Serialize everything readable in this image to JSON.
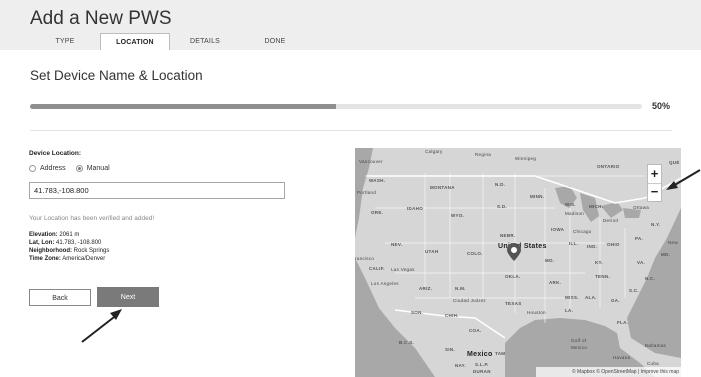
{
  "header": {
    "title": "Add a New PWS",
    "tabs": [
      "TYPE",
      "LOCATION",
      "DETAILS",
      "DONE"
    ],
    "active_tab": "LOCATION"
  },
  "section": {
    "title": "Set Device Name & Location"
  },
  "progress": {
    "value": 0.5,
    "label": "50%"
  },
  "form": {
    "device_location_label": "Device Location:",
    "radio_options": [
      {
        "label": "Address",
        "checked": false
      },
      {
        "label": "Manual",
        "checked": true
      }
    ],
    "coordinates_value": "41.783,-108.800",
    "verified_message": "Your Location has been verified and added!",
    "details": [
      {
        "key": "Elevation:",
        "value": "2061 m"
      },
      {
        "key": "Lat, Lon:",
        "value": "41.783, -108.800"
      },
      {
        "key": "Neighborhood:",
        "value": "Rock Springs"
      },
      {
        "key": "Time Zone:",
        "value": "America/Denver"
      }
    ],
    "back_label": "Back",
    "next_label": "Next"
  },
  "map": {
    "zoom_in": "+",
    "zoom_out": "−",
    "attribution": "© Mapbox © OpenStreetMap | Improve this map",
    "labels": {
      "calgary": "Calgary",
      "regina": "Regina",
      "winnipeg": "Winnipeg",
      "ontario": "ONTARIO",
      "que": "QUÉ",
      "vancouver": "Vancouver",
      "wash": "WASH.",
      "montana": "MONTANA",
      "nd": "N.D.",
      "minn": "MINN.",
      "portland": "Portland",
      "sd": "S.D.",
      "wis": "WIS.",
      "mich": "MICH.",
      "ottawa": "Ottawa",
      "ore": "ORE.",
      "idaho": "IDAHO",
      "wyo": "WYO.",
      "madison": "Madison",
      "detroit": "Detroit",
      "ny": "N.Y.",
      "iowa": "IOWA",
      "nebr": "NEBR.",
      "chicago": "Chicago",
      "nev": "NEV.",
      "utah": "UTAH",
      "colo": "COLO.",
      "us": "United States",
      "ill": "ILL.",
      "ind": "IND.",
      "ohio": "OHIO",
      "pa": "PA.",
      "new": "New",
      "francisco": "rancisco",
      "calif": "CALIF.",
      "lasvegas": "Las Vegas",
      "mo": "MO.",
      "ky": "KY.",
      "va": "VA.",
      "md": "MD.",
      "okla": "OKLA.",
      "tenn": "TENN.",
      "nc": "N.C.",
      "losangeles": "Los Angeles",
      "ariz": "ARIZ.",
      "nm": "N.M.",
      "ark": "ARK.",
      "sc": "S.C.",
      "juarez": "Ciudad Juárez",
      "texas": "TEXAS",
      "miss": "MISS.",
      "ala": "ALA.",
      "ga": "GA.",
      "son": "SON.",
      "chih": "CHIH.",
      "houston": "Houston",
      "la": "LA.",
      "coa": "COA.",
      "fla": "FLA.",
      "bcs": "B.C.S.",
      "gulf": "Gulf of",
      "mexico_gulf": "Mexico",
      "bahamas": "Bahamas",
      "sin": "SIN.",
      "havana": "Havana",
      "mexico": "Mexico",
      "tam": "TAM",
      "cuba": "Cuba",
      "nay": "NAY.",
      "slp": "S.L.P.",
      "duran": "DURAN"
    }
  },
  "colors": {
    "header_bg": "#eeeeee",
    "progress_fill": "#8f8f8f",
    "next_button": "#7a7a7a",
    "map_land": "#d6d6d6",
    "map_water": "#a8a8a8"
  }
}
